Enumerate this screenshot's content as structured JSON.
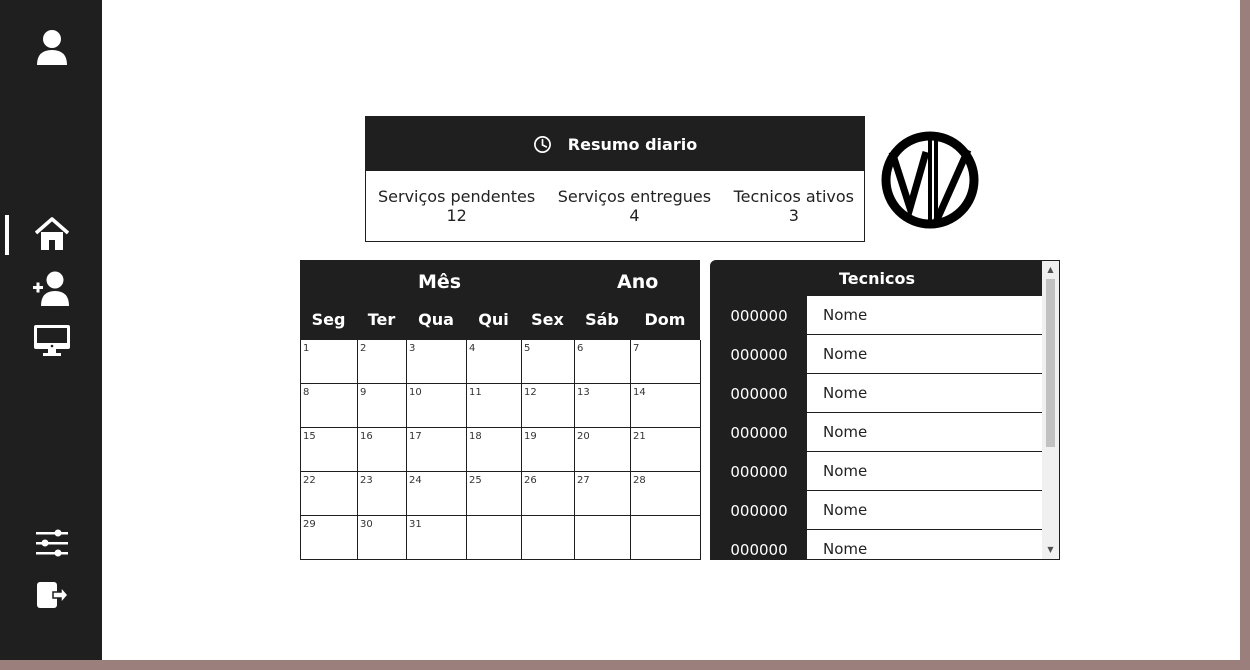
{
  "sidebar": {
    "items": [
      {
        "name": "profile",
        "icon": "user-icon"
      },
      {
        "name": "home",
        "icon": "home-icon",
        "active": true
      },
      {
        "name": "add-user",
        "icon": "user-plus-icon"
      },
      {
        "name": "monitor",
        "icon": "monitor-icon"
      },
      {
        "name": "settings",
        "icon": "sliders-icon"
      },
      {
        "name": "logout",
        "icon": "logout-icon"
      }
    ]
  },
  "summary": {
    "title": "Resumo diario",
    "icon": "clock-icon",
    "stats": [
      {
        "label": "Serviços pendentes",
        "value": "12"
      },
      {
        "label": "Serviços entregues",
        "value": "4"
      },
      {
        "label": "Tecnicos ativos",
        "value": "3"
      }
    ]
  },
  "calendar": {
    "month_label": "Mês",
    "year_label": "Ano",
    "weekdays": [
      "Seg",
      "Ter",
      "Qua",
      "Qui",
      "Sex",
      "Sáb",
      "Dom"
    ],
    "days": [
      "1",
      "2",
      "3",
      "4",
      "5",
      "6",
      "7",
      "8",
      "9",
      "10",
      "11",
      "12",
      "13",
      "14",
      "15",
      "16",
      "17",
      "18",
      "19",
      "20",
      "21",
      "22",
      "23",
      "24",
      "25",
      "26",
      "27",
      "28",
      "29",
      "30",
      "31",
      "",
      "",
      "",
      ""
    ]
  },
  "tecnicos": {
    "title": "Tecnicos",
    "rows": [
      {
        "id": "000000",
        "name": "Nome"
      },
      {
        "id": "000000",
        "name": "Nome"
      },
      {
        "id": "000000",
        "name": "Nome"
      },
      {
        "id": "000000",
        "name": "Nome"
      },
      {
        "id": "000000",
        "name": "Nome"
      },
      {
        "id": "000000",
        "name": "Nome"
      },
      {
        "id": "000000",
        "name": "Nome"
      }
    ]
  },
  "colors": {
    "sidebar_bg": "#1f1f1f",
    "accent": "#ffffff",
    "desktop_bg": "#9a7f7c"
  }
}
